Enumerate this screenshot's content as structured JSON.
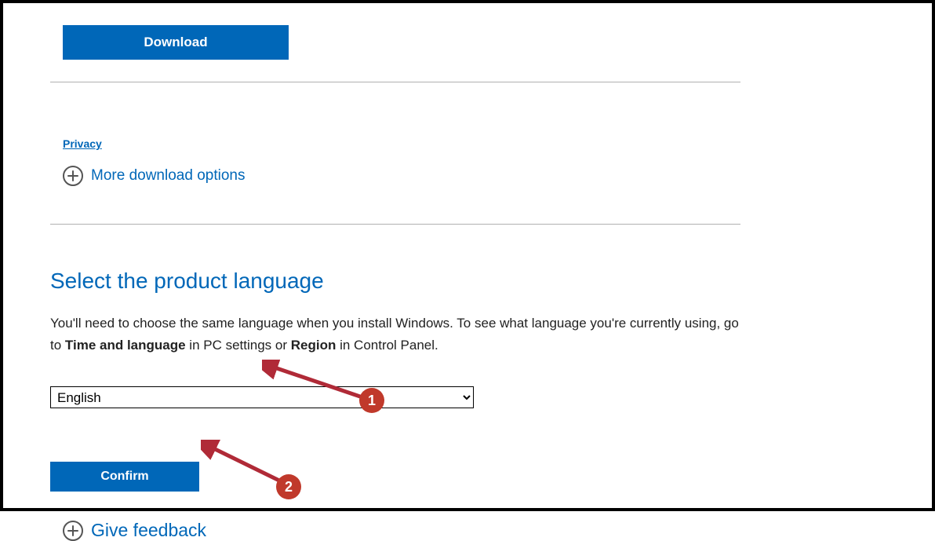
{
  "download_button": "Download",
  "privacy_link": "Privacy",
  "more_download_options": "More download options",
  "section_heading": "Select the product language",
  "instruction_prefix": "You'll need to choose the same language when you install Windows. To see what language you're currently using, go to ",
  "instruction_bold1": "Time and language",
  "instruction_mid": " in PC settings or ",
  "instruction_bold2": "Region",
  "instruction_suffix": " in Control Panel.",
  "language_selected": "English",
  "confirm_button": "Confirm",
  "give_feedback": "Give feedback",
  "annotation": {
    "badge1": "1",
    "badge2": "2"
  }
}
